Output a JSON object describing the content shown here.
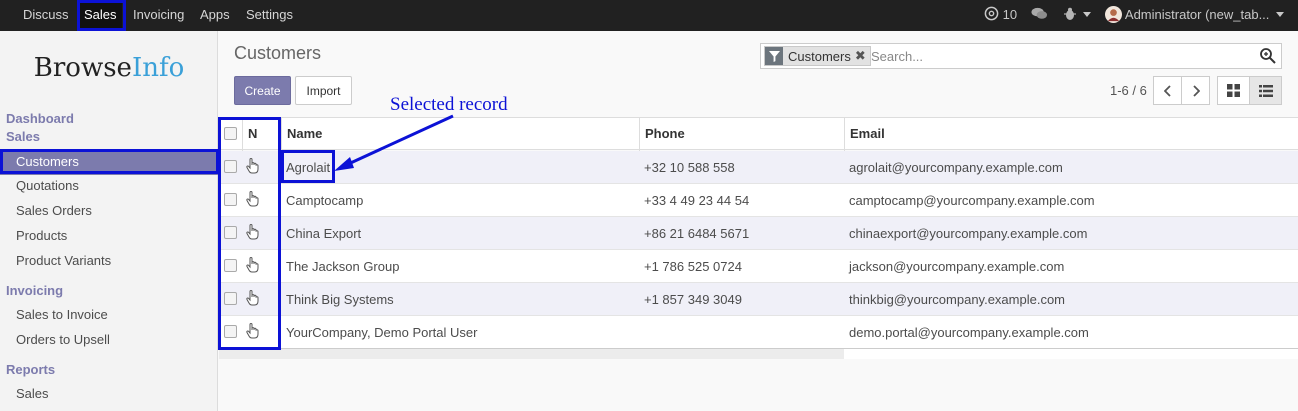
{
  "topbar": {
    "menu": [
      "Discuss",
      "Sales",
      "Invoicing",
      "Apps",
      "Settings"
    ],
    "active": "Sales",
    "activity_count": "10",
    "user_label": "Administrator (new_tab..."
  },
  "sidebar": {
    "logo_part1": "Browse",
    "logo_part2": "Info",
    "sections": [
      {
        "title": "Dashboard"
      },
      {
        "title": "Sales",
        "items": [
          "Customers",
          "Quotations",
          "Sales Orders",
          "Products",
          "Product Variants"
        ]
      },
      {
        "title": "Invoicing",
        "items": [
          "Sales to Invoice",
          "Orders to Upsell"
        ]
      },
      {
        "title": "Reports",
        "items": [
          "Sales"
        ]
      }
    ],
    "active_item": "Customers"
  },
  "control": {
    "title": "Customers",
    "create_label": "Create",
    "import_label": "Import",
    "search_facet": "Customers",
    "search_placeholder": "Search...",
    "pager": "1-6 / 6"
  },
  "annotation": {
    "label": "Selected record"
  },
  "table": {
    "columns": [
      "N",
      "Name",
      "Phone",
      "Email"
    ],
    "rows": [
      {
        "name": "Agrolait",
        "phone": "+32 10 588 558",
        "email": "agrolait@yourcompany.example.com"
      },
      {
        "name": "Camptocamp",
        "phone": "+33 4 49 23 44 54",
        "email": "camptocamp@yourcompany.example.com"
      },
      {
        "name": "China Export",
        "phone": "+86 21 6484 5671",
        "email": "chinaexport@yourcompany.example.com"
      },
      {
        "name": "The Jackson Group",
        "phone": "+1 786 525 0724",
        "email": "jackson@yourcompany.example.com"
      },
      {
        "name": "Think Big Systems",
        "phone": "+1 857 349 3049",
        "email": "thinkbig@yourcompany.example.com"
      },
      {
        "name": "YourCompany, Demo Portal User",
        "phone": "",
        "email": "demo.portal@yourcompany.example.com"
      }
    ]
  },
  "colors": {
    "brand": "#7c7bad",
    "annotation": "#0c12d6",
    "topbar": "#212121"
  }
}
